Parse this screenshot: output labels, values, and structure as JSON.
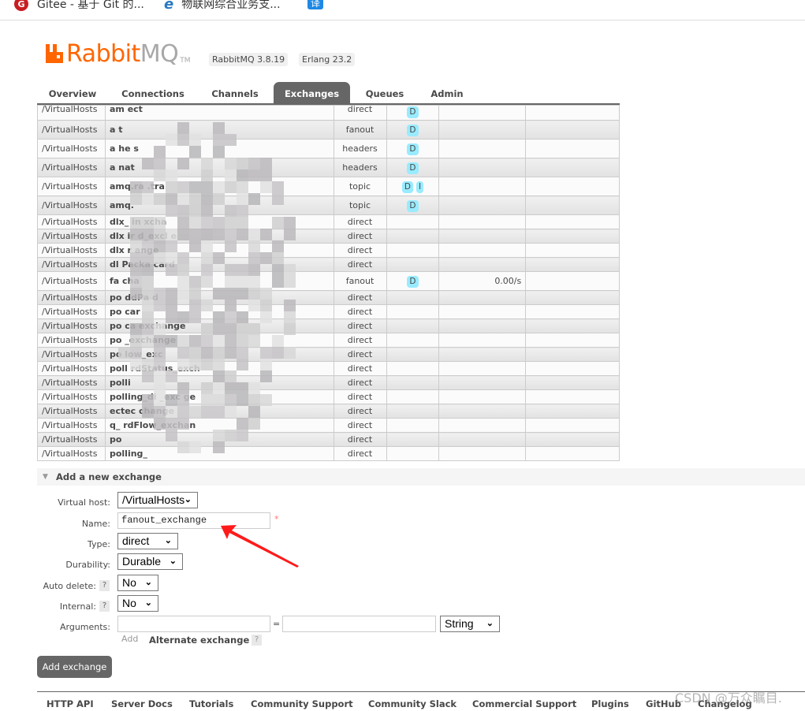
{
  "browser": {
    "bookmarks": [
      {
        "icon": "gitee-icon",
        "label": "Gitee - 基于 Git 的..."
      },
      {
        "icon": "ie-icon",
        "label": "物联网综合业务支..."
      },
      {
        "icon": "translate-icon",
        "label": "译"
      }
    ]
  },
  "header": {
    "logo_primary": "Rabbit",
    "logo_secondary": "MQ",
    "logo_tm": "TM",
    "version_badge": "RabbitMQ 3.8.19",
    "erlang_badge": "Erlang 23.2"
  },
  "tabs": [
    {
      "label": "Overview",
      "active": false
    },
    {
      "label": "Connections",
      "active": false
    },
    {
      "label": "Channels",
      "active": false
    },
    {
      "label": "Exchanges",
      "active": true
    },
    {
      "label": "Queues",
      "active": false
    },
    {
      "label": "Admin",
      "active": false
    }
  ],
  "exchanges": {
    "rows": [
      {
        "vhost": "/VirtualHosts",
        "name": "am      ect",
        "type": "direct",
        "features": [
          "D"
        ],
        "rate_in": "",
        "rate_out": ""
      },
      {
        "vhost": "/VirtualHosts",
        "name": "a         t",
        "type": "fanout",
        "features": [
          "D"
        ],
        "rate_in": "",
        "rate_out": ""
      },
      {
        "vhost": "/VirtualHosts",
        "name": "a    he    s",
        "type": "headers",
        "features": [
          "D"
        ],
        "rate_in": "",
        "rate_out": ""
      },
      {
        "vhost": "/VirtualHosts",
        "name": "a     nat",
        "type": "headers",
        "features": [
          "D"
        ],
        "rate_in": "",
        "rate_out": ""
      },
      {
        "vhost": "/VirtualHosts",
        "name": "amq.ra        .tra",
        "type": "topic",
        "features": [
          "D",
          "I"
        ],
        "rate_in": "",
        "rate_out": ""
      },
      {
        "vhost": "/VirtualHosts",
        "name": "amq.",
        "type": "topic",
        "features": [
          "D"
        ],
        "rate_in": "",
        "rate_out": ""
      },
      {
        "vhost": "/VirtualHosts",
        "name": "dlx_     in      xcha",
        "type": "direct",
        "features": [],
        "rate_in": "",
        "rate_out": ""
      },
      {
        "vhost": "/VirtualHosts",
        "name": "dlx     ir      d_excl    e",
        "type": "direct",
        "features": [],
        "rate_in": "",
        "rate_out": ""
      },
      {
        "vhost": "/VirtualHosts",
        "name": "dlx      r       ange",
        "type": "direct",
        "features": [],
        "rate_in": "",
        "rate_out": ""
      },
      {
        "vhost": "/VirtualHosts",
        "name": "dl            Packa     card",
        "type": "direct",
        "features": [],
        "rate_in": "",
        "rate_out": ""
      },
      {
        "vhost": "/VirtualHosts",
        "name": "fa        cha",
        "type": "fanout",
        "features": [
          "D"
        ],
        "rate_in": "0.00/s",
        "rate_out": ""
      },
      {
        "vhost": "/VirtualHosts",
        "name": "po        ddPa          d",
        "type": "direct",
        "features": [],
        "rate_in": "",
        "rate_out": ""
      },
      {
        "vhost": "/VirtualHosts",
        "name": "po       car",
        "type": "direct",
        "features": [],
        "rate_in": "",
        "rate_out": ""
      },
      {
        "vhost": "/VirtualHosts",
        "name": "po       ca                 exchange",
        "type": "direct",
        "features": [],
        "rate_in": "",
        "rate_out": ""
      },
      {
        "vhost": "/VirtualHosts",
        "name": "po                             _exchange",
        "type": "direct",
        "features": [],
        "rate_in": "",
        "rate_out": ""
      },
      {
        "vhost": "/VirtualHosts",
        "name": "po                 low_exc",
        "type": "direct",
        "features": [],
        "rate_in": "",
        "rate_out": ""
      },
      {
        "vhost": "/VirtualHosts",
        "name": "poll          rdStatus_exch",
        "type": "direct",
        "features": [],
        "rate_in": "",
        "rate_out": ""
      },
      {
        "vhost": "/VirtualHosts",
        "name": "polli",
        "type": "direct",
        "features": [],
        "rate_in": "",
        "rate_out": ""
      },
      {
        "vhost": "/VirtualHosts",
        "name": "polling_di                   _exc   ge",
        "type": "direct",
        "features": [],
        "rate_in": "",
        "rate_out": ""
      },
      {
        "vhost": "/VirtualHosts",
        "name": "                          ectec    change",
        "type": "direct",
        "features": [],
        "rate_in": "",
        "rate_out": ""
      },
      {
        "vhost": "/VirtualHosts",
        "name": "     q_           rdFlow_exchan",
        "type": "direct",
        "features": [],
        "rate_in": "",
        "rate_out": ""
      },
      {
        "vhost": "/VirtualHosts",
        "name": "po",
        "type": "direct",
        "features": [],
        "rate_in": "",
        "rate_out": ""
      },
      {
        "vhost": "/VirtualHosts",
        "name": "polling_",
        "type": "direct",
        "features": [],
        "rate_in": "",
        "rate_out": ""
      }
    ]
  },
  "add_exchange": {
    "title": "Add a new exchange",
    "virtual_host_label": "Virtual host:",
    "virtual_host_value": "/VirtualHosts",
    "name_label": "Name:",
    "name_value": "fanout_exchange",
    "required_mark": "*",
    "type_label": "Type:",
    "type_value": "direct",
    "durability_label": "Durability:",
    "durability_value": "Durable",
    "auto_delete_label": "Auto delete:",
    "auto_delete_value": "No",
    "internal_label": "Internal:",
    "internal_value": "No",
    "arguments_label": "Arguments:",
    "arguments_key": "",
    "arguments_equals": "=",
    "arguments_value": "",
    "arguments_type": "String",
    "help_mark": "?",
    "add_link": "Add",
    "alternate_exchange_link": "Alternate exchange",
    "submit_label": "Add exchange"
  },
  "footer": {
    "links": [
      "HTTP API",
      "Server Docs",
      "Tutorials",
      "Community Support",
      "Community Slack",
      "Commercial Support",
      "Plugins",
      "GitHub",
      "Changelog"
    ]
  },
  "watermark": "CSDN @万众瞩目."
}
